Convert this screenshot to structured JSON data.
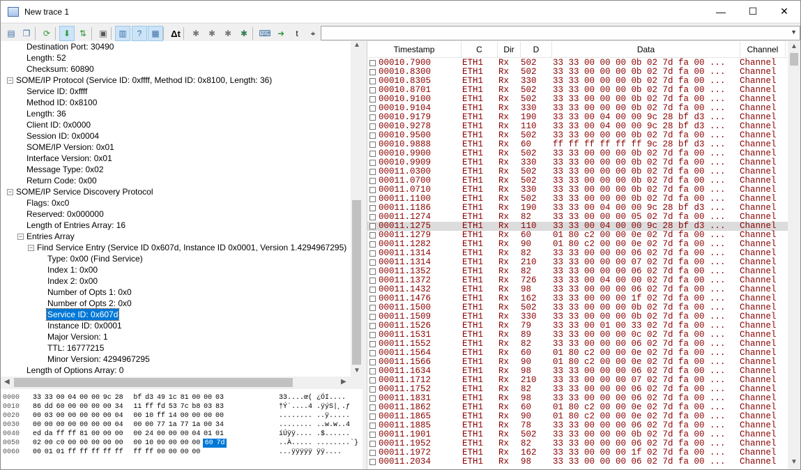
{
  "window": {
    "title": "New trace 1",
    "minimize": "—",
    "maximize": "☐",
    "close": "✕"
  },
  "toolbar": {
    "buttons": [
      {
        "name": "new-trace-icon",
        "glyph": "▤"
      },
      {
        "name": "copy-icon",
        "glyph": "❐"
      },
      {
        "name": "refresh-icon",
        "glyph": "⟳"
      },
      {
        "name": "import-icon",
        "glyph": "⬇"
      },
      {
        "name": "auto-scroll-icon",
        "glyph": "⇅"
      },
      {
        "name": "settings-icon",
        "glyph": "▣"
      },
      {
        "name": "layout-icon",
        "glyph": "▥"
      },
      {
        "name": "help-icon",
        "glyph": "?"
      },
      {
        "name": "details-icon",
        "glyph": "▦"
      },
      {
        "name": "delta-time-icon",
        "glyph": "Δt"
      },
      {
        "name": "filter-icon",
        "glyph": "✱"
      },
      {
        "name": "filter-prev-icon",
        "glyph": "✱"
      },
      {
        "name": "filter-next-icon",
        "glyph": "✱"
      },
      {
        "name": "filter-clear-icon",
        "glyph": "✱"
      },
      {
        "name": "keyboard-icon",
        "glyph": "⌨"
      },
      {
        "name": "go-icon",
        "glyph": "➜"
      },
      {
        "name": "goto-time-icon",
        "glyph": "t"
      },
      {
        "name": "binoculars-icon",
        "glyph": "⌖"
      }
    ],
    "delta_label": "Δt",
    "filter_value": ""
  },
  "tree": [
    {
      "text": "Destination Port: 30490",
      "level": 2
    },
    {
      "text": "Length: 52",
      "level": 2
    },
    {
      "text": "Checksum: 60890",
      "level": 2
    },
    {
      "text": "SOME/IP Protocol (Service ID: 0xffff, Method ID: 0x8100, Length: 36)",
      "level": 1,
      "exp": "−"
    },
    {
      "text": "Service ID: 0xffff",
      "level": 2
    },
    {
      "text": "Method ID: 0x8100",
      "level": 2
    },
    {
      "text": "Length: 36",
      "level": 2
    },
    {
      "text": "Client ID: 0x0000",
      "level": 2
    },
    {
      "text": "Session ID: 0x0004",
      "level": 2
    },
    {
      "text": "SOME/IP Version: 0x01",
      "level": 2
    },
    {
      "text": "Interface Version: 0x01",
      "level": 2
    },
    {
      "text": "Message Type: 0x02",
      "level": 2
    },
    {
      "text": "Return Code: 0x00",
      "level": 2
    },
    {
      "text": "SOME/IP Service Discovery Protocol",
      "level": 1,
      "exp": "−"
    },
    {
      "text": "Flags: 0xc0",
      "level": 2
    },
    {
      "text": "Reserved: 0x000000",
      "level": 2
    },
    {
      "text": "Length of Entries Array: 16",
      "level": 2
    },
    {
      "text": "Entries Array",
      "level": 2,
      "exp": "−"
    },
    {
      "text": "Find Service Entry (Service ID 0x607d, Instance ID 0x0001, Version 1.4294967295)",
      "level": 3,
      "exp": "−"
    },
    {
      "text": "Type: 0x00 (Find Service)",
      "level": 4
    },
    {
      "text": "Index 1: 0x00",
      "level": 4
    },
    {
      "text": "Index 2: 0x00",
      "level": 4
    },
    {
      "text": "Number of Opts 1: 0x0",
      "level": 4
    },
    {
      "text": "Number of Opts 2: 0x0",
      "level": 4
    },
    {
      "text": "Service ID: 0x607d",
      "level": 4,
      "selected": true
    },
    {
      "text": "Instance ID: 0x0001",
      "level": 4
    },
    {
      "text": "Major Version: 1",
      "level": 4
    },
    {
      "text": "TTL: 16777215",
      "level": 4
    },
    {
      "text": "Minor Version: 4294967295",
      "level": 4
    },
    {
      "text": "Length of Options Array: 0",
      "level": 2
    }
  ],
  "hex": [
    {
      "off": "0000",
      "b": [
        "33",
        "33",
        "00",
        "04",
        "00",
        "00",
        "9c",
        "28",
        "bf",
        "d3",
        "49",
        "1c",
        "81",
        "00",
        "00",
        "03"
      ],
      "ascii": "33....œ( ¿ÓI...."
    },
    {
      "off": "0010",
      "b": [
        "86",
        "dd",
        "60",
        "00",
        "00",
        "00",
        "00",
        "34",
        "11",
        "ff",
        "fd",
        "53",
        "7c",
        "b8",
        "03",
        "83"
      ],
      "ascii": "†Ý`....4 .ÿýS|¸.ƒ"
    },
    {
      "off": "0020",
      "b": [
        "00",
        "03",
        "00",
        "00",
        "00",
        "00",
        "00",
        "04",
        "00",
        "10",
        "ff",
        "14",
        "00",
        "00",
        "00",
        "00"
      ],
      "ascii": "........ ..ÿ....."
    },
    {
      "off": "0030",
      "b": [
        "00",
        "00",
        "00",
        "00",
        "00",
        "00",
        "00",
        "04",
        "00",
        "00",
        "77",
        "1a",
        "77",
        "1a",
        "00",
        "34"
      ],
      "ascii": "........ ..w.w..4"
    },
    {
      "off": "0040",
      "b": [
        "ed",
        "da",
        "ff",
        "ff",
        "81",
        "00",
        "00",
        "00",
        "00",
        "24",
        "00",
        "00",
        "00",
        "04",
        "01",
        "01"
      ],
      "ascii": "íÚÿÿ.... .$......"
    },
    {
      "off": "0050",
      "b": [
        "02",
        "00",
        "c0",
        "00",
        "00",
        "00",
        "00",
        "00",
        "00",
        "10",
        "00",
        "00",
        "00",
        "00",
        "60",
        "7d"
      ],
      "ascii": "..À..... ........`}",
      "sel": [
        14,
        15
      ]
    },
    {
      "off": "0060",
      "b": [
        "00",
        "01",
        "01",
        "ff",
        "ff",
        "ff",
        "ff",
        "ff",
        "ff",
        "ff",
        "00",
        "00",
        "00",
        "00"
      ],
      "ascii": "...ÿÿÿÿÿ ÿÿ...."
    }
  ],
  "grid": {
    "headers": [
      "Timestamp",
      "C",
      "Dir",
      "D",
      "Data",
      "Channel"
    ],
    "rows": [
      [
        "00010.7900",
        "ETH1",
        "Rx",
        "502",
        "33 33 00 00 00 0b 02 7d fa 00 ...",
        "Channel"
      ],
      [
        "00010.8300",
        "ETH1",
        "Rx",
        "502",
        "33 33 00 00 00 0b 02 7d fa 00 ...",
        "Channel"
      ],
      [
        "00010.8305",
        "ETH1",
        "Rx",
        "330",
        "33 33 00 00 00 0b 02 7d fa 00 ...",
        "Channel"
      ],
      [
        "00010.8701",
        "ETH1",
        "Rx",
        "502",
        "33 33 00 00 00 0b 02 7d fa 00 ...",
        "Channel"
      ],
      [
        "00010.9100",
        "ETH1",
        "Rx",
        "502",
        "33 33 00 00 00 0b 02 7d fa 00 ...",
        "Channel"
      ],
      [
        "00010.9104",
        "ETH1",
        "Rx",
        "330",
        "33 33 00 00 00 0b 02 7d fa 00 ...",
        "Channel"
      ],
      [
        "00010.9179",
        "ETH1",
        "Rx",
        "190",
        "33 33 00 04 00 00 9c 28 bf d3 ...",
        "Channel"
      ],
      [
        "00010.9278",
        "ETH1",
        "Rx",
        "110",
        "33 33 00 04 00 00 9c 28 bf d3 ...",
        "Channel"
      ],
      [
        "00010.9500",
        "ETH1",
        "Rx",
        "502",
        "33 33 00 00 00 0b 02 7d fa 00 ...",
        "Channel"
      ],
      [
        "00010.9888",
        "ETH1",
        "Rx",
        "60",
        "ff ff ff ff ff ff 9c 28 bf d3 ...",
        "Channel"
      ],
      [
        "00010.9900",
        "ETH1",
        "Rx",
        "502",
        "33 33 00 00 00 0b 02 7d fa 00 ...",
        "Channel"
      ],
      [
        "00010.9909",
        "ETH1",
        "Rx",
        "330",
        "33 33 00 00 00 0b 02 7d fa 00 ...",
        "Channel"
      ],
      [
        "00011.0300",
        "ETH1",
        "Rx",
        "502",
        "33 33 00 00 00 0b 02 7d fa 00 ...",
        "Channel"
      ],
      [
        "00011.0700",
        "ETH1",
        "Rx",
        "502",
        "33 33 00 00 00 0b 02 7d fa 00 ...",
        "Channel"
      ],
      [
        "00011.0710",
        "ETH1",
        "Rx",
        "330",
        "33 33 00 00 00 0b 02 7d fa 00 ...",
        "Channel"
      ],
      [
        "00011.1100",
        "ETH1",
        "Rx",
        "502",
        "33 33 00 00 00 0b 02 7d fa 00 ...",
        "Channel"
      ],
      [
        "00011.1186",
        "ETH1",
        "Rx",
        "190",
        "33 33 00 04 00 00 9c 28 bf d3 ...",
        "Channel"
      ],
      [
        "00011.1274",
        "ETH1",
        "Rx",
        "82",
        "33 33 00 00 00 05 02 7d fa 00 ...",
        "Channel"
      ],
      [
        "00011.1275",
        "ETH1",
        "Rx",
        "110",
        "33 33 00 04 00 00 9c 28 bf d3 ...",
        "Channel"
      ],
      [
        "00011.1279",
        "ETH1",
        "Rx",
        "60",
        "01 80 c2 00 00 0e 02 7d fa 00 ...",
        "Channel"
      ],
      [
        "00011.1282",
        "ETH1",
        "Rx",
        "90",
        "01 80 c2 00 00 0e 02 7d fa 00 ...",
        "Channel"
      ],
      [
        "00011.1314",
        "ETH1",
        "Rx",
        "82",
        "33 33 00 00 00 06 02 7d fa 00 ...",
        "Channel"
      ],
      [
        "00011.1314",
        "ETH1",
        "Rx",
        "210",
        "33 33 00 00 00 07 02 7d fa 00 ...",
        "Channel"
      ],
      [
        "00011.1352",
        "ETH1",
        "Rx",
        "82",
        "33 33 00 00 00 06 02 7d fa 00 ...",
        "Channel"
      ],
      [
        "00011.1372",
        "ETH1",
        "Rx",
        "726",
        "33 33 00 04 00 00 02 7d fa 00 ...",
        "Channel"
      ],
      [
        "00011.1432",
        "ETH1",
        "Rx",
        "98",
        "33 33 00 00 00 06 02 7d fa 00 ...",
        "Channel"
      ],
      [
        "00011.1476",
        "ETH1",
        "Rx",
        "162",
        "33 33 00 00 00 1f 02 7d fa 00 ...",
        "Channel"
      ],
      [
        "00011.1500",
        "ETH1",
        "Rx",
        "502",
        "33 33 00 00 00 0b 02 7d fa 00 ...",
        "Channel"
      ],
      [
        "00011.1509",
        "ETH1",
        "Rx",
        "330",
        "33 33 00 00 00 0b 02 7d fa 00 ...",
        "Channel"
      ],
      [
        "00011.1526",
        "ETH1",
        "Rx",
        "79",
        "33 33 00 01 00 33 02 7d fa 00 ...",
        "Channel"
      ],
      [
        "00011.1531",
        "ETH1",
        "Rx",
        "89",
        "33 33 00 00 00 0c 02 7d fa 00 ...",
        "Channel"
      ],
      [
        "00011.1552",
        "ETH1",
        "Rx",
        "82",
        "33 33 00 00 00 06 02 7d fa 00 ...",
        "Channel"
      ],
      [
        "00011.1564",
        "ETH1",
        "Rx",
        "60",
        "01 80 c2 00 00 0e 02 7d fa 00 ...",
        "Channel"
      ],
      [
        "00011.1566",
        "ETH1",
        "Rx",
        "90",
        "01 80 c2 00 00 0e 02 7d fa 00 ...",
        "Channel"
      ],
      [
        "00011.1634",
        "ETH1",
        "Rx",
        "98",
        "33 33 00 00 00 06 02 7d fa 00 ...",
        "Channel"
      ],
      [
        "00011.1712",
        "ETH1",
        "Rx",
        "210",
        "33 33 00 00 00 07 02 7d fa 00 ...",
        "Channel"
      ],
      [
        "00011.1752",
        "ETH1",
        "Rx",
        "82",
        "33 33 00 00 00 06 02 7d fa 00 ...",
        "Channel"
      ],
      [
        "00011.1831",
        "ETH1",
        "Rx",
        "98",
        "33 33 00 00 00 06 02 7d fa 00 ...",
        "Channel"
      ],
      [
        "00011.1862",
        "ETH1",
        "Rx",
        "60",
        "01 80 c2 00 00 0e 02 7d fa 00 ...",
        "Channel"
      ],
      [
        "00011.1865",
        "ETH1",
        "Rx",
        "90",
        "01 80 c2 00 00 0e 02 7d fa 00 ...",
        "Channel"
      ],
      [
        "00011.1885",
        "ETH1",
        "Rx",
        "78",
        "33 33 00 00 00 06 02 7d fa 00 ...",
        "Channel"
      ],
      [
        "00011.1901",
        "ETH1",
        "Rx",
        "502",
        "33 33 00 00 00 0b 02 7d fa 00 ...",
        "Channel"
      ],
      [
        "00011.1952",
        "ETH1",
        "Rx",
        "82",
        "33 33 00 00 00 06 02 7d fa 00 ...",
        "Channel"
      ],
      [
        "00011.1972",
        "ETH1",
        "Rx",
        "162",
        "33 33 00 00 00 1f 02 7d fa 00 ...",
        "Channel"
      ],
      [
        "00011.2034",
        "ETH1",
        "Rx",
        "98",
        "33 33 00 00 00 06 02 7d fa 00 ...",
        "Channel"
      ]
    ],
    "highlight_index": 18
  },
  "colors": {
    "row_text": "#8b0000",
    "selection": "#0078d7"
  }
}
